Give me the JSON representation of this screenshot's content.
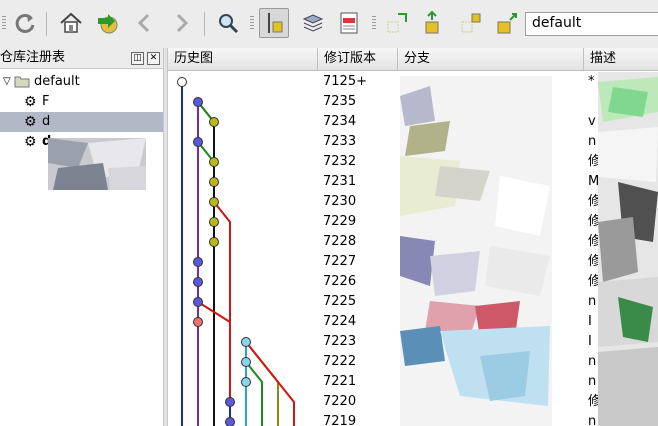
{
  "toolbar": {
    "icons": [
      "refresh-icon",
      "home-icon",
      "pull-icon",
      "back-icon",
      "forward-icon",
      "find-icon",
      "revision-graph-icon",
      "stack-icon",
      "log-icon",
      "add-file-icon",
      "push-icon",
      "unknown-file-icon",
      "sync-icon"
    ],
    "repo_selected": "default"
  },
  "left_panel": {
    "title": "仓库注册表",
    "root": "default",
    "children": [
      "F",
      "d",
      "d"
    ]
  },
  "columns": {
    "graph": "历史图",
    "revision": "修订版本",
    "branch": "分支",
    "description": "描述"
  },
  "rows": [
    {
      "rev": "7125+",
      "desc": "*"
    },
    {
      "rev": "7235",
      "desc": ""
    },
    {
      "rev": "7234",
      "desc": "v"
    },
    {
      "rev": "7233",
      "desc": "n"
    },
    {
      "rev": "7232",
      "desc": "修"
    },
    {
      "rev": "7231",
      "desc": "M"
    },
    {
      "rev": "7230",
      "desc": "修"
    },
    {
      "rev": "7229",
      "desc": "修"
    },
    {
      "rev": "7228",
      "desc": "修"
    },
    {
      "rev": "7227",
      "desc": "修"
    },
    {
      "rev": "7226",
      "desc": "修"
    },
    {
      "rev": "7225",
      "desc": "n"
    },
    {
      "rev": "7224",
      "desc": "I"
    },
    {
      "rev": "7223",
      "desc": "I"
    },
    {
      "rev": "7222",
      "desc": "n"
    },
    {
      "rev": "7221",
      "desc": "n"
    },
    {
      "rev": "7220",
      "desc": "修"
    },
    {
      "rev": "7219",
      "desc": "n"
    }
  ],
  "colors": {
    "lane_blue": "#1f2d8a",
    "lane_purple": "#7a2aa0",
    "lane_red": "#d01515",
    "lane_green": "#1a8a1a",
    "lane_olive": "#8a8a10",
    "lane_cyan": "#2aa5c8",
    "node_blue": "#5a5ad8",
    "node_olive": "#b8b818",
    "node_red": "#ee7070",
    "node_cyan": "#8ad4ee"
  }
}
